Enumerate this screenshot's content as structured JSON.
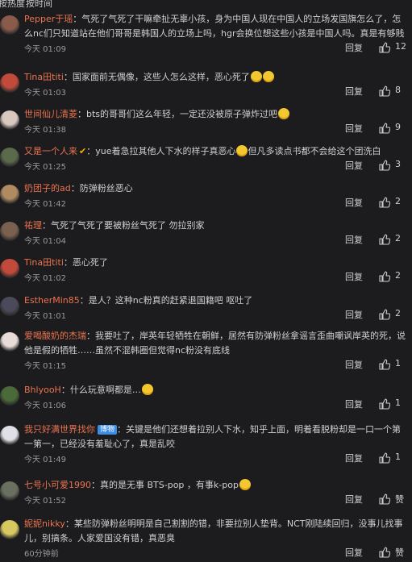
{
  "tabs": [
    "按热度",
    "按时间"
  ],
  "reply_label": "回复",
  "comments": [
    {
      "user": "Pepper于瑶",
      "text": "：气死了气死了干嘛牵扯无辜小孩，身为中国人现在中国人的立场发国旗怎么了，怎么nc们只知道站在他们哥哥是韩国人的立场上吗，hgr会换位想这些小孩是中国人吗。真是有够贱",
      "time": "今天 01:09",
      "likes": "12",
      "avatar_color": "#8a5a4a"
    },
    {
      "user": "Tina田titi",
      "text": "：国家面前无偶像，这些人怎么这样，恶心死了",
      "time": "今天 01:03",
      "likes": "8",
      "avatar_color": "#c24a3a"
    },
    {
      "user": "世间仙儿清菱",
      "text": "：bts的哥哥们这么年轻，一定还没被原子弹炸过吧",
      "time": "今天 01:38",
      "likes": "9",
      "avatar_color": "#d9c8c0"
    },
    {
      "user": "又是一个人来",
      "text": "：yue着急拉其他人下水的样子真恶心",
      "text2": "但凡多读点书都不会给这个团洗白",
      "time": "今天 01:25",
      "likes": "3",
      "avatar_color": "#5a6a4a"
    },
    {
      "user": "奶团子的ad",
      "text": "：防弹粉丝恶心",
      "time": "今天 01:42",
      "likes": "2",
      "avatar_color": "#b08a60"
    },
    {
      "user": "祐理",
      "text": "：气死了气死了要被粉丝气死了 勿拉别家",
      "time": "今天 01:04",
      "likes": "2",
      "avatar_color": "#7a6050"
    },
    {
      "user": "Tina田titi",
      "text": "：恶心死了",
      "time": "今天 01:02",
      "likes": "2",
      "avatar_color": "#c24a3a"
    },
    {
      "user": "EstherMin85",
      "text": "：是人？这种nc粉真的赶紧退国籍吧 呕吐了",
      "time": "今天 01:01",
      "likes": "2",
      "avatar_color": "#4a4a5a"
    },
    {
      "user": "爱喝酸奶的杰瑞",
      "text": "：我要吐了，岸英年轻牺牲在朝鲜，居然有防弹粉丝拿谣言歪曲嘲讽岸英的死，说他是假的牺牲……虽然不混韩圈但觉得nc粉没有底线",
      "time": "今天 01:15",
      "likes": "1",
      "avatar_color": "#e8dcd8"
    },
    {
      "user": "BhlyooH",
      "text": "：什么玩意啊都是…",
      "time": "今天 01:06",
      "likes": "1",
      "avatar_color": "#4a6a3a"
    },
    {
      "user": "我只好满世界找你",
      "badge": "博物",
      "text": "：关键是他们还想着拉别人下水，知乎上面，明着看脱粉却是一口一个第一第一，已经没有羞耻心了，真是乱咬",
      "time": "今天 01:49",
      "likes": "1",
      "avatar_color": "#e0e0e8"
    },
    {
      "user": "七号小可爱1990",
      "text": "：真的是无事 BTS-pop ，有事k-pop",
      "time": "今天 01:52",
      "likes": "赞",
      "avatar_color": "#6a7060"
    },
    {
      "user": "妮妮nikky",
      "text": "：某些防弹粉丝明明是自己割割的错，非要拉别人垫背。NCT刚陆续回归，没事儿找事儿，别搞条。人家爱国没有错，真恶臭",
      "time": "60分钟前",
      "likes": "赞",
      "avatar_color": "#d8c860"
    }
  ]
}
